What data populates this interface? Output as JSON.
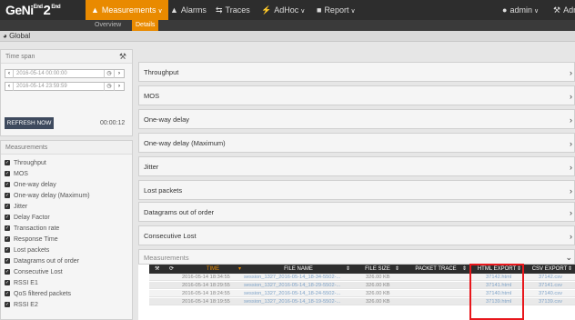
{
  "topbar": {
    "logo": {
      "geni": "GeNi",
      "end": "End",
      "two": "2",
      "end2": "End"
    },
    "nav": [
      {
        "label": "Measurements",
        "icon": "bar-chart-icon",
        "active": true
      },
      {
        "label": "Alarms",
        "icon": "bell-icon"
      },
      {
        "label": "Traces",
        "icon": "arrows-icon"
      },
      {
        "label": "AdHoc",
        "icon": "bolt-icon"
      },
      {
        "label": "Report",
        "icon": "document-icon"
      }
    ],
    "user": "admin",
    "admin_short": "Adm"
  },
  "subnav": {
    "overview": "Overview",
    "details": "Details"
  },
  "scope": "Global",
  "timespan": {
    "title": "Time span",
    "start": "2016-05-14 00:00:00",
    "end": "2016-05-14 23:59:59",
    "refresh_label": "REFRESH NOW",
    "countdown": "00:00:12"
  },
  "measurements_panel": {
    "title": "Measurements",
    "items": [
      "Throughput",
      "MOS",
      "One-way delay",
      "One-way delay (Maximum)",
      "Jitter",
      "Delay Factor",
      "Transaction rate",
      "Response Time",
      "Lost packets",
      "Datagrams out of order",
      "Consecutive Lost",
      "RSSI E1",
      "QoS filtered packets",
      "RSSI E2"
    ]
  },
  "rows": [
    "Throughput",
    "MOS",
    "One-way delay",
    "One-way delay (Maximum)",
    "Jitter",
    "Lost packets",
    "Datagrams out of order",
    "Consecutive Lost"
  ],
  "measurements_section": "Measurements",
  "table": {
    "headers": {
      "time": "TIME",
      "file_name": "FILE NAME",
      "file_size": "FILE SIZE",
      "packet_trace": "PACKET TRACE",
      "html_export": "HTML EXPORT",
      "csv_export": "CSV EXPORT"
    },
    "rows": [
      {
        "time": "2016-05-14 18:34:55",
        "file": "session_1327_2016-05-14_18-34-5502-...",
        "size": "326.00 KB",
        "html": "37142.html",
        "csv": "37142.csv"
      },
      {
        "time": "2016-05-14 18:29:55",
        "file": "session_1327_2016-05-14_18-29-5502-...",
        "size": "326.00 KB",
        "html": "37141.html",
        "csv": "37141.csv"
      },
      {
        "time": "2016-05-14 18:24:55",
        "file": "session_1327_2016-05-14_18-24-5502-...",
        "size": "326.00 KB",
        "html": "37140.html",
        "csv": "37140.csv"
      },
      {
        "time": "2016-05-14 18:19:55",
        "file": "session_1327_2016-05-14_18-19-5502-...",
        "size": "326.00 KB",
        "html": "37139.html",
        "csv": "37139.csv"
      }
    ]
  },
  "colors": {
    "accent": "#e98a00",
    "nav_bg": "#2d2d2d",
    "highlight": "#e8171c",
    "link": "#7fa3c8"
  }
}
